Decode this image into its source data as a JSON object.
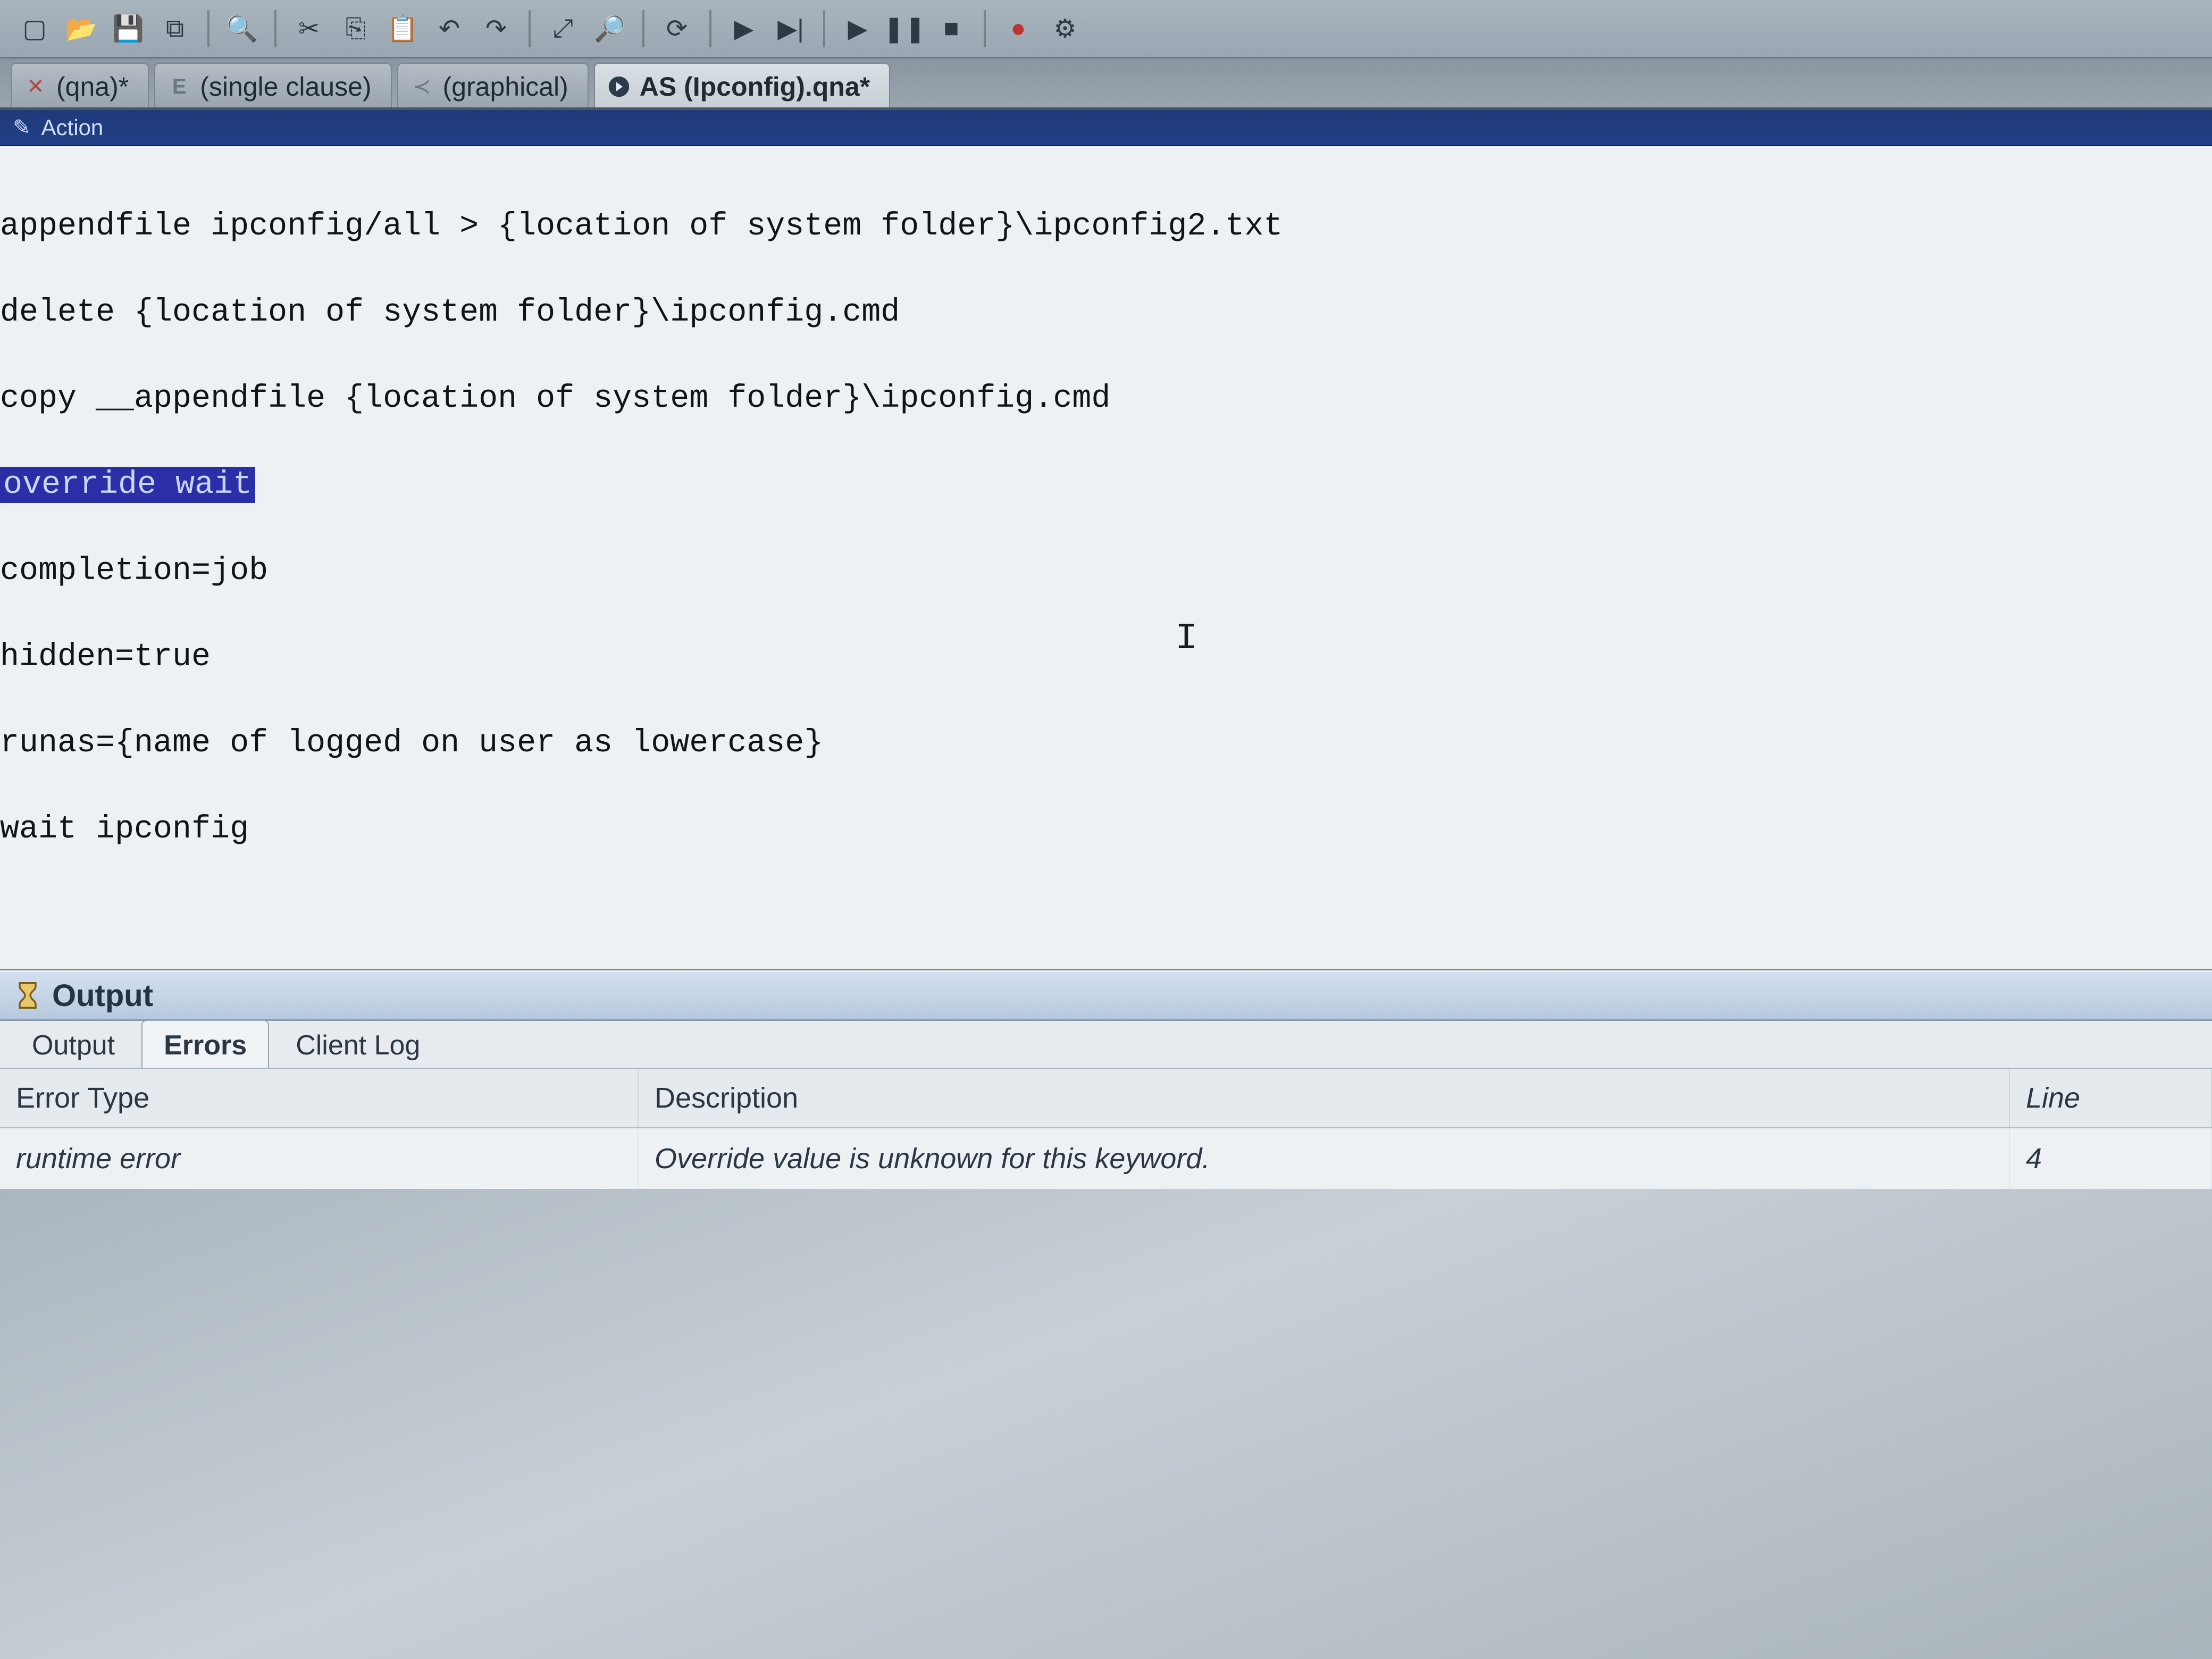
{
  "toolbar": {
    "icons": [
      "new",
      "open",
      "save",
      "save-all",
      "search",
      "cut",
      "copy",
      "paste",
      "undo",
      "redo",
      "zoom-fit",
      "zoom",
      "refresh",
      "run",
      "run-step",
      "stop-run",
      "play",
      "pause",
      "stop",
      "record",
      "macro"
    ]
  },
  "tabs": [
    {
      "label": "(qna)*",
      "icon": "x-icon",
      "active": false
    },
    {
      "label": "(single clause)",
      "icon": "e-icon",
      "active": false
    },
    {
      "label": "(graphical)",
      "icon": "relevance-icon",
      "active": false
    },
    {
      "label": "AS (Ipconfig).qna*",
      "icon": "arrow-right-circle-icon",
      "active": true
    }
  ],
  "editor_bar": {
    "title": "Action"
  },
  "editor": {
    "lines": [
      "appendfile ipconfig/all > {location of system folder}\\ipconfig2.txt",
      "delete {location of system folder}\\ipconfig.cmd",
      "copy __appendfile {location of system folder}\\ipconfig.cmd"
    ],
    "selected_line": "override wait",
    "lines_after": [
      "completion=job",
      "hidden=true",
      "runas={name of logged on user as lowercase}",
      "wait ipconfig"
    ],
    "caret_glyph": "I"
  },
  "output": {
    "panel_title": "Output",
    "subtabs": [
      {
        "label": "Output",
        "active": false
      },
      {
        "label": "Errors",
        "active": true
      },
      {
        "label": "Client Log",
        "active": false
      }
    ],
    "columns": {
      "type": "Error Type",
      "desc": "Description",
      "line": "Line"
    },
    "rows": [
      {
        "type": "runtime error",
        "desc": "Override value is unknown for this keyword.",
        "line": "4"
      }
    ]
  }
}
